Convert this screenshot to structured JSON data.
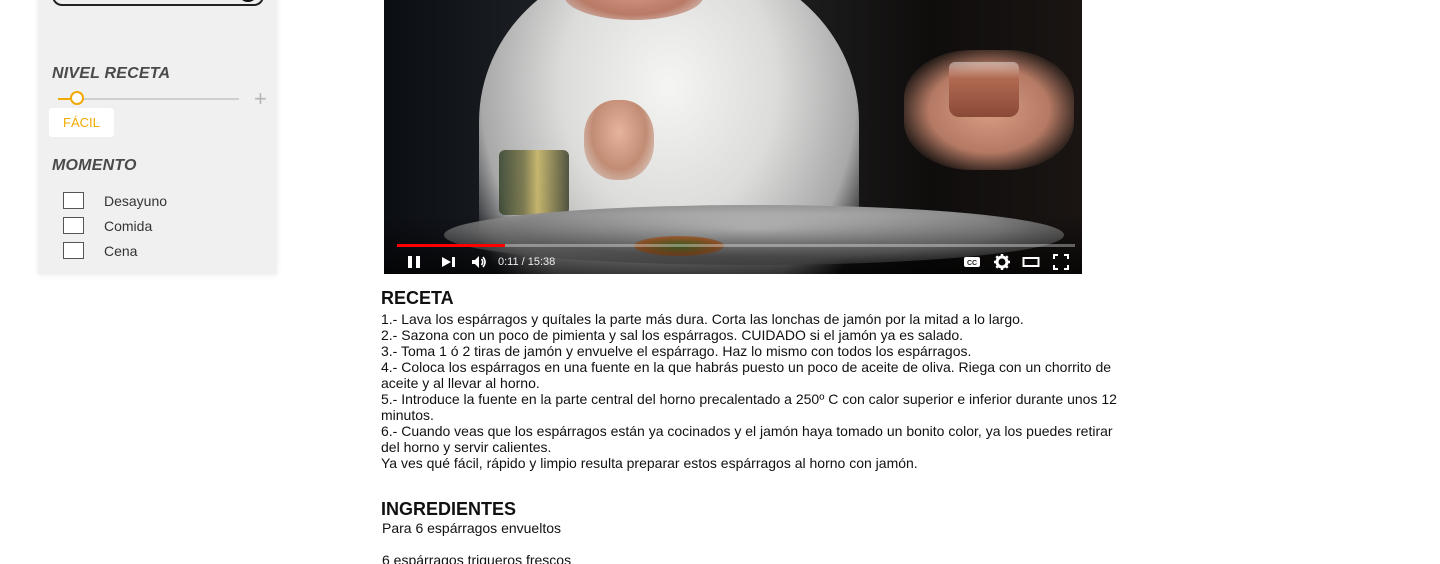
{
  "sidebar": {
    "level_title": "NIVEL RECETA",
    "level_value": "FÁCIL",
    "level_slider_fraction": 0.05,
    "moment_title": "MOMENTO",
    "moment_options": [
      "Desayuno",
      "Comida",
      "Cena"
    ]
  },
  "video": {
    "time_display": "0:11 / 15:38",
    "progress_fraction": 0.16,
    "progress_color": "#ff0000"
  },
  "recipe": {
    "title": "RECETA",
    "steps": [
      "1.- Lava los espárragos y quítales la parte más dura. Corta las lonchas de jamón por la mitad a lo largo.",
      "2.- Sazona con un poco de pimienta y sal los espárragos. CUIDADO si el jamón ya es salado.",
      "3.- Toma 1 ó 2 tiras de jamón y envuelve el espárrago.  Haz lo mismo con todos los espárragos.",
      "4.- Coloca los espárragos en una fuente en la que habrás puesto un poco de aceite de oliva. Riega con un chorrito de aceite y al llevar al horno.",
      "5.- Introduce la fuente en la parte central del horno precalentado  a 250º C con calor superior e inferior durante unos 12 minutos.",
      "6.- Cuando veas que los espárragos están ya cocinados y el jamón haya tomado un bonito color, ya los puedes retirar del horno y servir calientes.",
      "Ya ves qué fácil, rápido y limpio resulta preparar estos espárragos al horno con jamón."
    ]
  },
  "ingredients": {
    "title": "INGREDIENTES",
    "servings": "Para 6 espárragos envueltos",
    "items": [
      "6 espárragos trigueros frescos"
    ]
  },
  "colors": {
    "accent": "#f2a900",
    "sidebar_bg": "#f0f0f0"
  }
}
